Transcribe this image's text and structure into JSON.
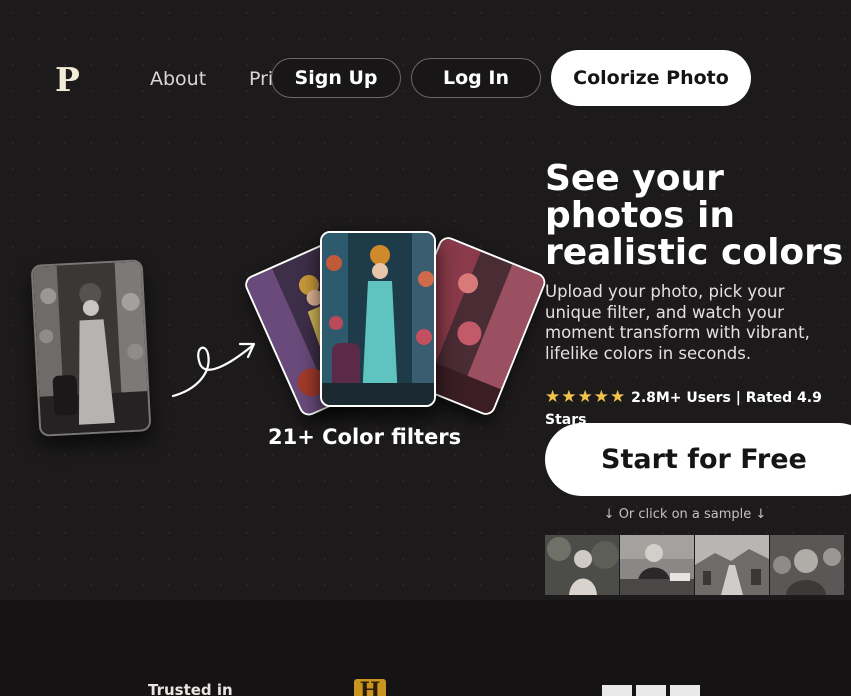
{
  "brand": {
    "logo_letter": "P"
  },
  "nav": {
    "about": "About",
    "pricing_partial": "Pri",
    "signup": "Sign Up",
    "login": "Log In",
    "colorize": "Colorize Photo"
  },
  "hero": {
    "headline": "See your photos in realistic colors",
    "subtext": "Upload your photo, pick your unique filter, and watch your moment transform with vibrant, lifelike colors in seconds.",
    "stars": "★★★★★",
    "rating_text": "2.8M+ Users | Rated 4.9 Stars",
    "cta": "Start for Free",
    "sample_hint": "↓ Or click on a sample ↓",
    "filters_caption": "21+ Color filters"
  },
  "samples": [
    {
      "name": "sample-woman-garden"
    },
    {
      "name": "sample-man-desk"
    },
    {
      "name": "sample-street-scene"
    },
    {
      "name": "sample-mother-children"
    }
  ],
  "trusted": {
    "label": "Trusted in",
    "logo_h": "H",
    "logo_bbc": "BBC"
  },
  "colors": {
    "background": "#1c1a1b",
    "gold": "#c9951f",
    "star": "#f2c34b",
    "cta_bg": "#ffffff"
  }
}
